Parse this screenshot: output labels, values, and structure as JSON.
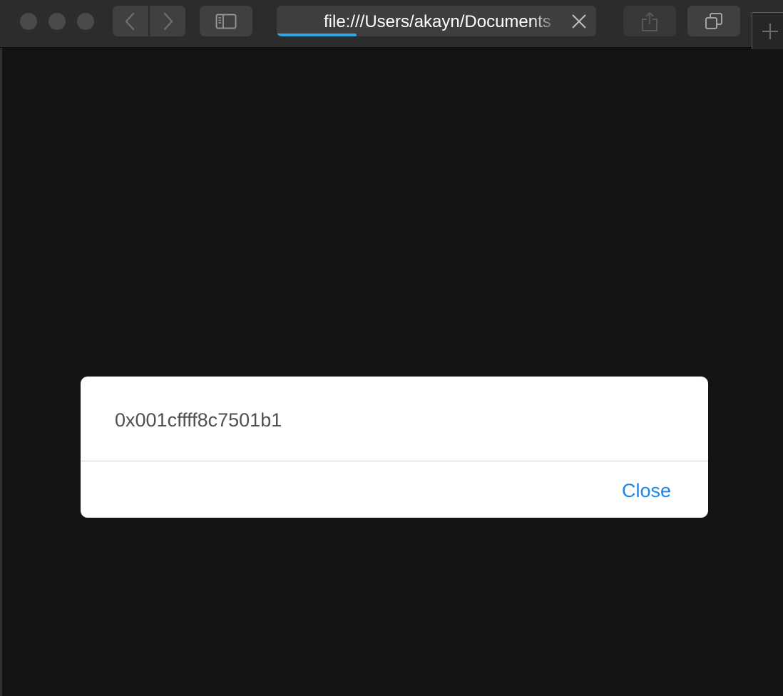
{
  "window": {
    "traffic_lights": [
      "close",
      "minimize",
      "zoom"
    ]
  },
  "toolbar": {
    "back_icon": "chevron-left-icon",
    "forward_icon": "chevron-right-icon",
    "sidebar_icon": "sidebar-icon",
    "share_icon": "share-icon",
    "tabs_icon": "tabs-overview-icon",
    "new_tab_icon": "plus-icon",
    "progress_fraction": 0.25
  },
  "address_bar": {
    "url": "file:///Users/akayn/Documents",
    "clear_icon": "close-icon"
  },
  "dialog": {
    "message": "0x001cffff8c7501b1",
    "close_label": "Close",
    "close_color": "#1a86f0"
  }
}
